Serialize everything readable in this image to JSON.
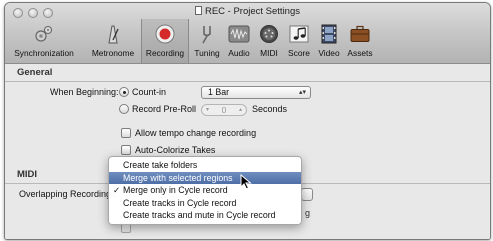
{
  "window": {
    "title": "REC - Project Settings"
  },
  "toolbar": {
    "items": [
      {
        "label": "Synchronization",
        "icon": "gears-icon",
        "selected": false
      },
      {
        "label": "Metronome",
        "icon": "metronome-icon",
        "selected": false
      },
      {
        "label": "Recording",
        "icon": "record-icon",
        "selected": true
      },
      {
        "label": "Tuning",
        "icon": "tuning-fork-icon",
        "selected": false
      },
      {
        "label": "Audio",
        "icon": "audio-waveform-icon",
        "selected": false
      },
      {
        "label": "MIDI",
        "icon": "midi-port-icon",
        "selected": false
      },
      {
        "label": "Score",
        "icon": "score-notes-icon",
        "selected": false
      },
      {
        "label": "Video",
        "icon": "film-strip-icon",
        "selected": false
      },
      {
        "label": "Assets",
        "icon": "briefcase-icon",
        "selected": false
      }
    ]
  },
  "general": {
    "heading": "General",
    "when_beginning_label": "When Beginning:",
    "count_in_label": "Count-in",
    "count_in_selected": true,
    "count_in_value": "1 Bar",
    "pre_roll_label": "Record Pre-Roll",
    "pre_roll_value": "0",
    "pre_roll_unit": "Seconds",
    "allow_tempo_label": "Allow tempo change recording",
    "auto_colorize_label": "Auto-Colorize Takes"
  },
  "midi": {
    "heading": "MIDI",
    "overlapping_label": "Overlapping Recordings:"
  },
  "popup_menu": {
    "items": [
      {
        "label": "Create take folders",
        "checked": false,
        "highlighted": false
      },
      {
        "label": "Merge with selected regions",
        "checked": false,
        "highlighted": true
      },
      {
        "label": "Merge only in Cycle record",
        "checked": true,
        "highlighted": false
      },
      {
        "label": "Create tracks in Cycle record",
        "checked": false,
        "highlighted": false
      },
      {
        "label": "Create tracks and mute in Cycle record",
        "checked": false,
        "highlighted": false
      }
    ]
  },
  "colors": {
    "highlight": "#5577b0",
    "record_red": "#d42a2a"
  }
}
